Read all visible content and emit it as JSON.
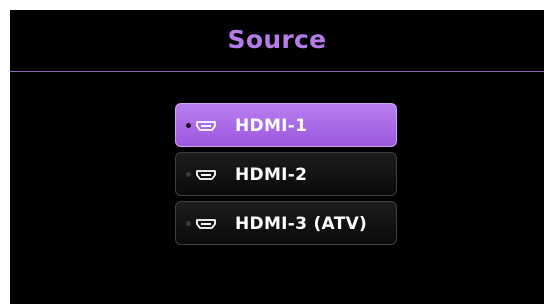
{
  "source_menu": {
    "title": "Source",
    "items": [
      {
        "label": "HDMI-1",
        "icon": "hdmi-port-icon",
        "selected": true
      },
      {
        "label": "HDMI-2",
        "icon": "hdmi-port-icon",
        "selected": false
      },
      {
        "label": "HDMI-3 (ATV)",
        "icon": "hdmi-port-icon",
        "selected": false
      }
    ]
  },
  "colors": {
    "background": "#000000",
    "accent": "#b67cea",
    "selected_item": "#a865e4",
    "text": "#ffffff"
  }
}
